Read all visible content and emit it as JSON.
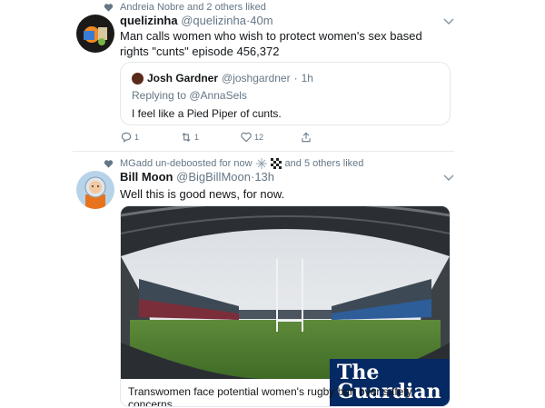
{
  "tweet1": {
    "social_context": "Andreia Nobre and 2 others liked",
    "display_name": "quelizinha",
    "handle": "@quelizinha",
    "time": "40m",
    "text": "Man calls women who wish to protect women's sex based rights \"cunts\" episode 456,372",
    "quote": {
      "display_name": "Josh Gardner",
      "handle": "@joshgardner",
      "time": "1h",
      "replying_to": "Replying to @AnnaSels",
      "text": "I feel like a Pied Piper of cunts."
    },
    "actions": {
      "replies": "1",
      "retweets": "1",
      "likes": "12"
    }
  },
  "tweet2": {
    "social_context": "MGadd un-deboosted for now",
    "social_context_tail": "and 5 others liked",
    "display_name": "Bill Moon",
    "handle": "@BigBillMoon",
    "time": "13h",
    "text": "Well this is good news, for now.",
    "card": {
      "logo_line1": "The",
      "logo_line2": "Guardian",
      "caption": "Transwomen face potential women's rugby ban over safety concerns"
    }
  },
  "colors": {
    "secondary_text": "#657786",
    "guardian_blue": "#052962",
    "divider": "#e6ecf0"
  },
  "icons": [
    "heart-icon",
    "reply-icon",
    "retweet-icon",
    "share-icon",
    "chevron-down-icon",
    "snowflake-icon",
    "checkered-flag-icon"
  ]
}
